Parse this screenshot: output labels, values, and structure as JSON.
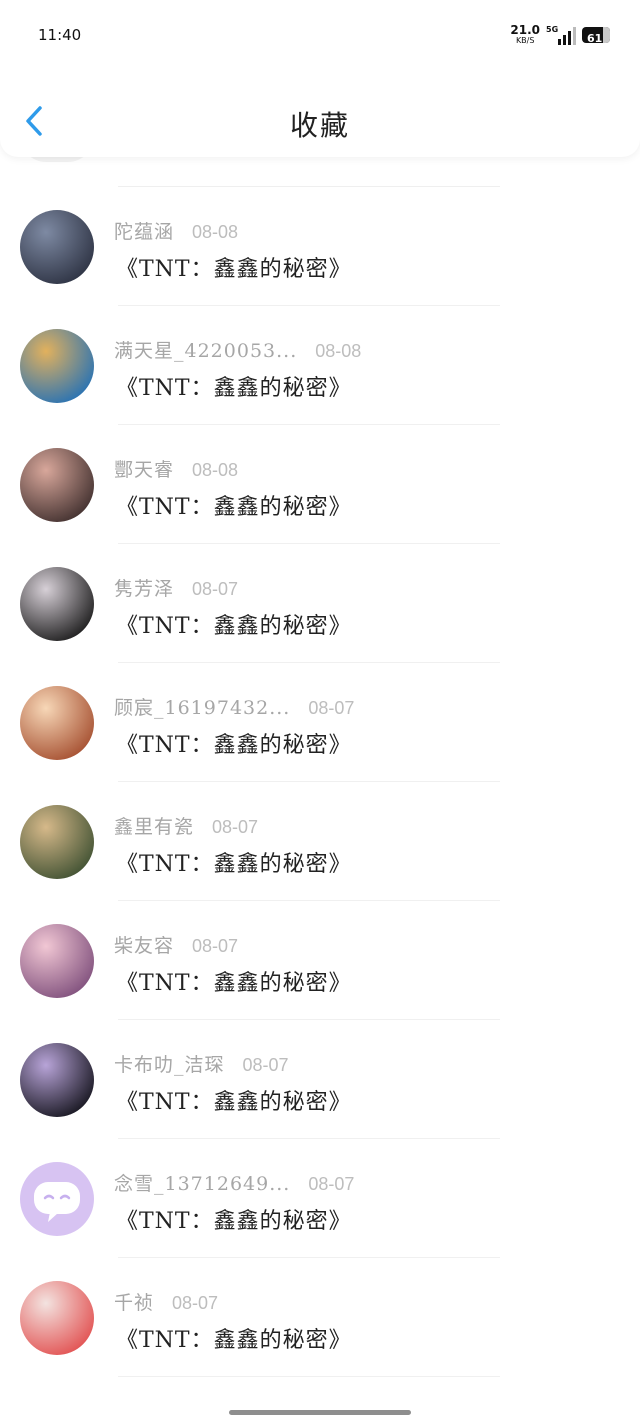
{
  "status": {
    "time": "11:40",
    "net_speed": "21.0",
    "net_unit": "KB/S",
    "network": "5G",
    "battery": "61"
  },
  "header": {
    "title": "收藏",
    "back_icon": "chevron-left-icon",
    "accent": "#2f9bea"
  },
  "items": [
    {
      "name": "陀蕴涵",
      "date": "08-08",
      "title": "《TNT：鑫鑫的秘密》",
      "avatar": [
        "#2a2f3f",
        "#7e8aa3"
      ]
    },
    {
      "name": "满天星_4220053...",
      "date": "08-08",
      "title": "《TNT：鑫鑫的秘密》",
      "avatar": [
        "#1f6fb8",
        "#e2b15d"
      ]
    },
    {
      "name": "酆天睿",
      "date": "08-08",
      "title": "《TNT：鑫鑫的秘密》",
      "avatar": [
        "#3b2b2a",
        "#d8a79b"
      ]
    },
    {
      "name": "隽芳泽",
      "date": "08-07",
      "title": "《TNT：鑫鑫的秘密》",
      "avatar": [
        "#151515",
        "#d7d0d7"
      ]
    },
    {
      "name": "顾宸_16197432...",
      "date": "08-07",
      "title": "《TNT：鑫鑫的秘密》",
      "avatar": [
        "#a24a2b",
        "#f7d7b7"
      ]
    },
    {
      "name": "鑫里有瓷",
      "date": "08-07",
      "title": "《TNT：鑫鑫的秘密》",
      "avatar": [
        "#3a4d2f",
        "#d6b98a"
      ]
    },
    {
      "name": "柴友容",
      "date": "08-07",
      "title": "《TNT：鑫鑫的秘密》",
      "avatar": [
        "#7b4b79",
        "#f1c7d4"
      ]
    },
    {
      "name": "卡布叻_洁琛",
      "date": "08-07",
      "title": "《TNT：鑫鑫的秘密》",
      "avatar": [
        "#101018",
        "#b8a4d8"
      ]
    },
    {
      "name": "念雪_13712649...",
      "date": "08-07",
      "title": "《TNT：鑫鑫的秘密》",
      "avatar": [
        "#d7c3f2",
        "#d7c3f2"
      ],
      "avatar_icon": "chat-bubble-icon"
    },
    {
      "name": "千祯",
      "date": "08-07",
      "title": "《TNT：鑫鑫的秘密》",
      "avatar": [
        "#e14b4b",
        "#f3e3e0"
      ]
    }
  ]
}
